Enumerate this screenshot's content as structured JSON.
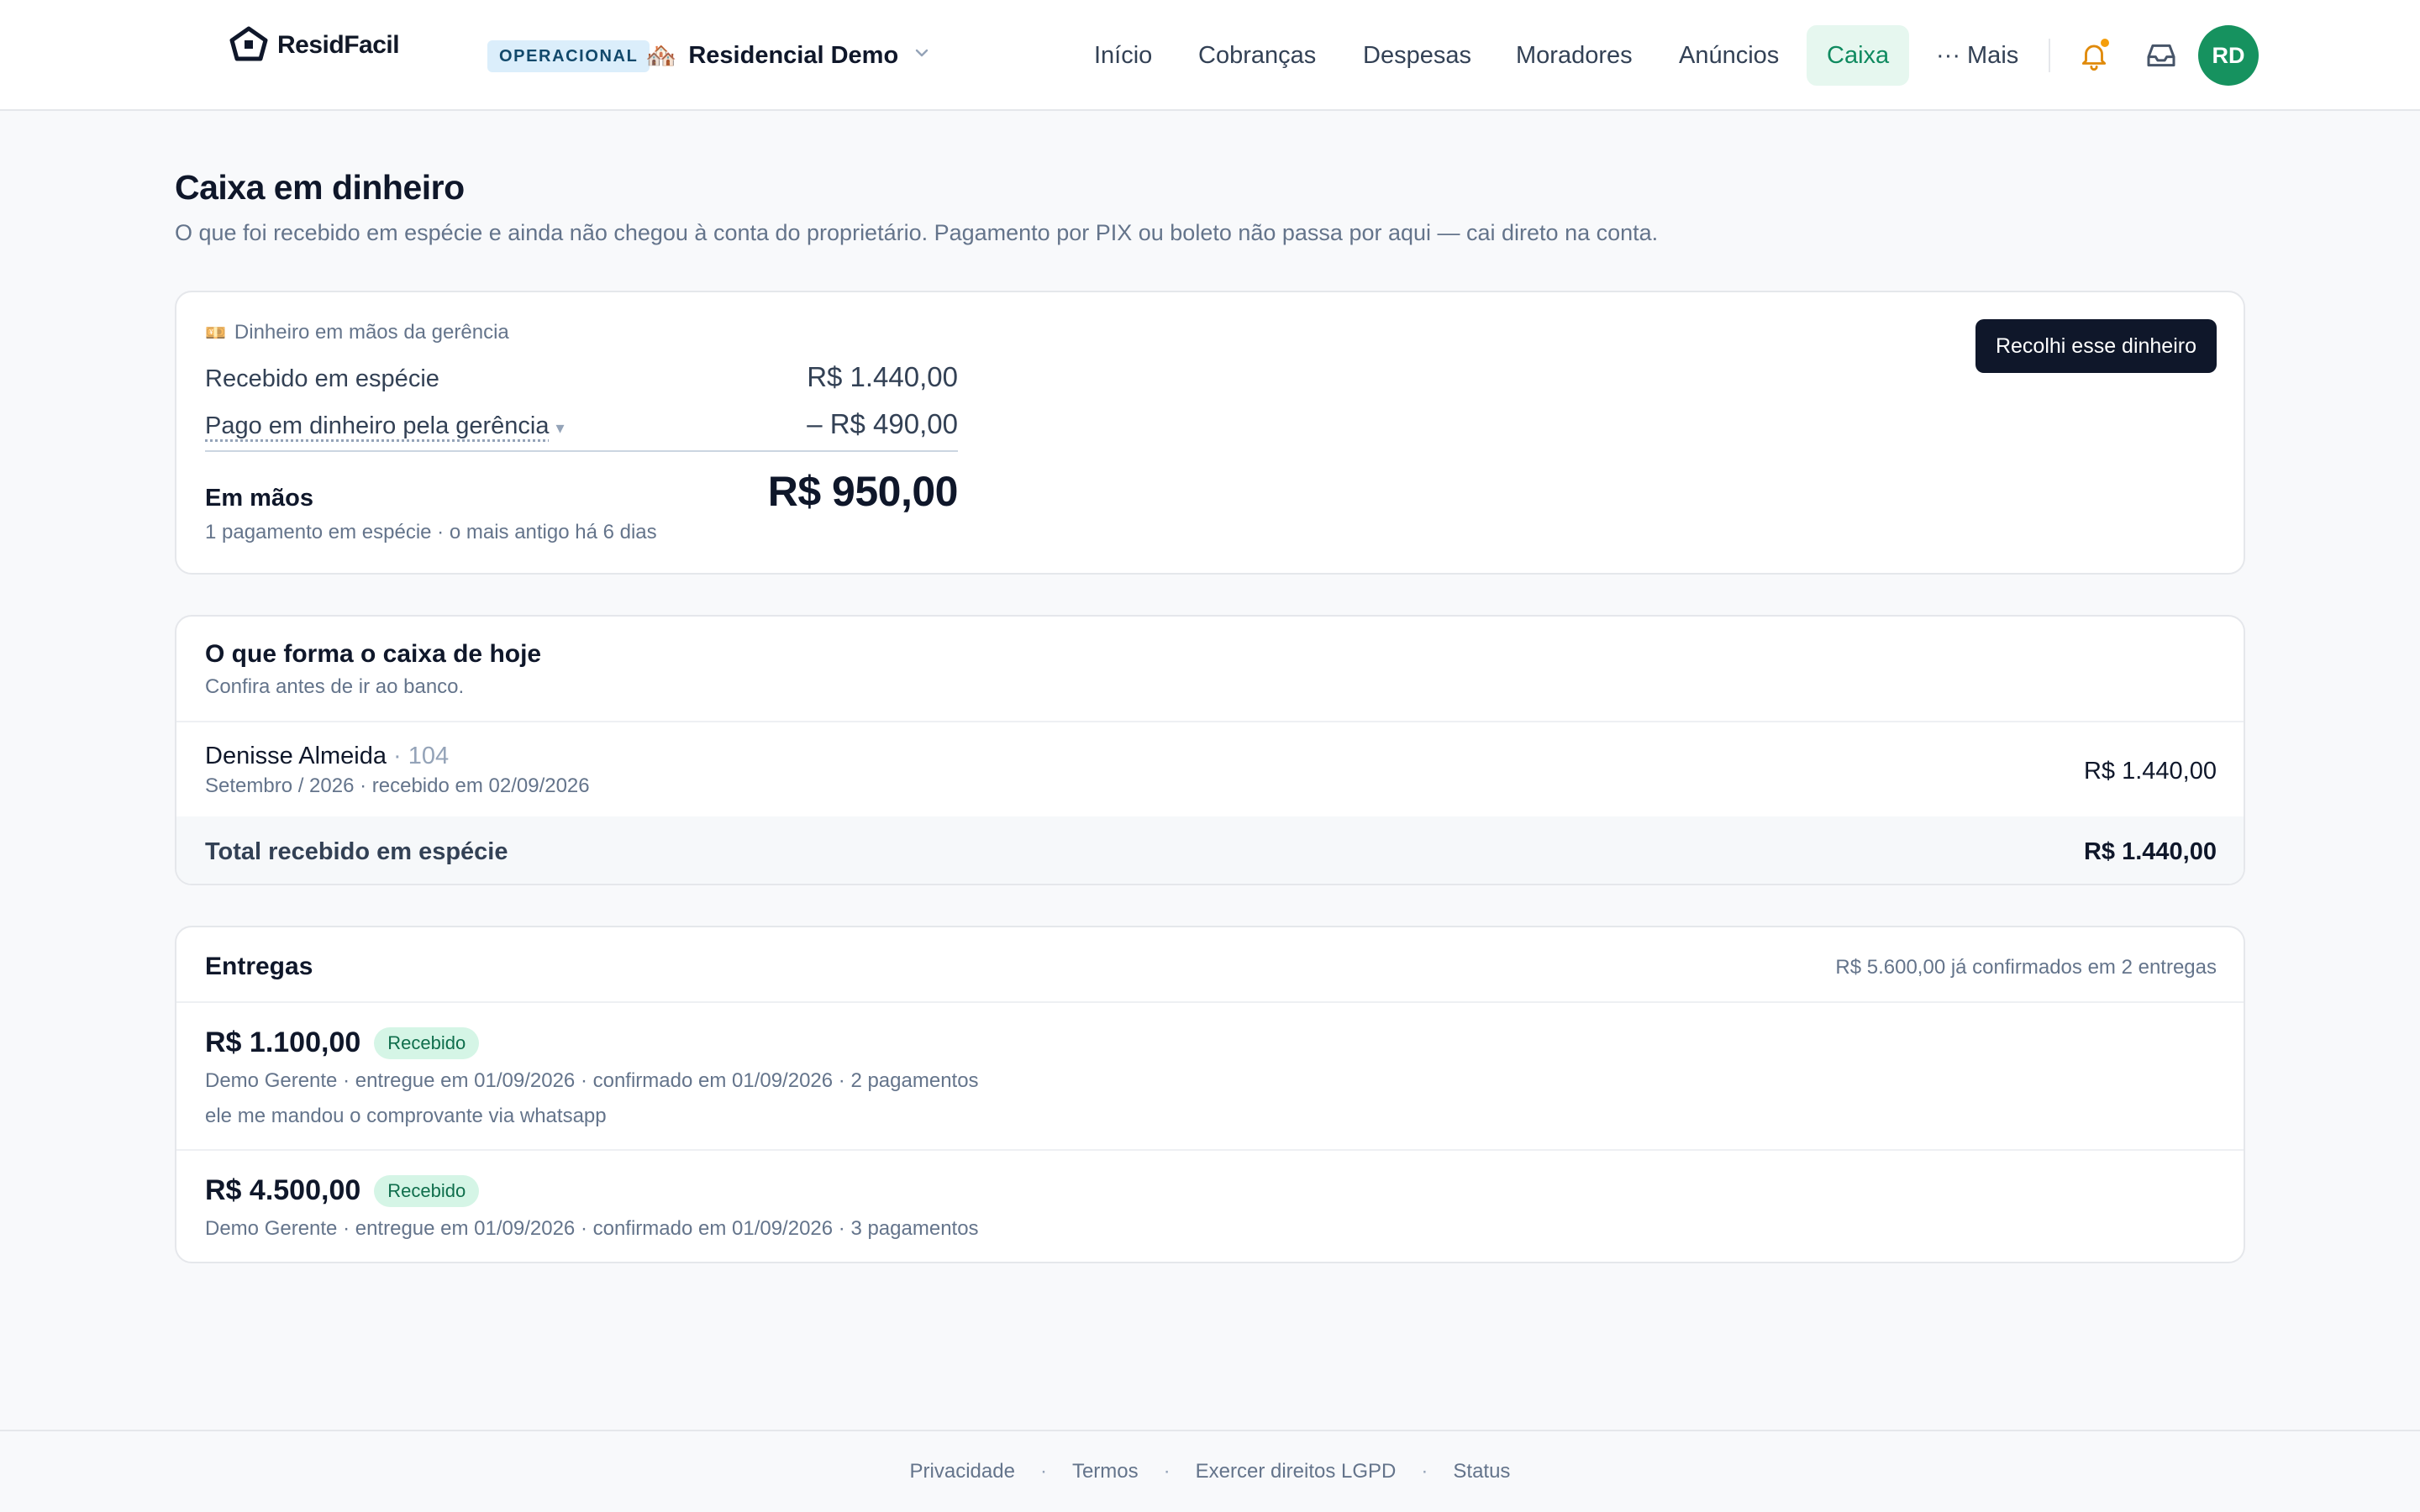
{
  "app": {
    "brand": "ResidFacil",
    "status_badge": "OPERACIONAL",
    "condo_emoji": "🏘️",
    "condo_name": "Residencial Demo"
  },
  "nav": {
    "items": [
      {
        "label": "Início",
        "active": false
      },
      {
        "label": "Cobranças",
        "active": false
      },
      {
        "label": "Despesas",
        "active": false
      },
      {
        "label": "Moradores",
        "active": false
      },
      {
        "label": "Anúncios",
        "active": false
      },
      {
        "label": "Caixa",
        "active": true
      },
      {
        "label": "··· Mais",
        "active": false
      }
    ],
    "user_initials": "RD"
  },
  "page": {
    "title": "Caixa em dinheiro",
    "subtitle": "O que foi recebido em espécie e ainda não chegou à conta do proprietário. Pagamento por PIX ou boleto não passa por aqui — cai direto na conta."
  },
  "cash_summary": {
    "kicker_emoji": "💴",
    "kicker": "Dinheiro em mãos da gerência",
    "received_label": "Recebido em espécie",
    "received_value": "R$ 1.440,00",
    "paid_label": "Pago em dinheiro pela gerência",
    "paid_value": "– R$ 490,00",
    "in_hand_label": "Em mãos",
    "in_hand_value": "R$ 950,00",
    "footnote": "1 pagamento em espécie · o mais antigo há 6 dias",
    "collect_button": "Recolhi esse dinheiro"
  },
  "today_box": {
    "title": "O que forma o caixa de hoje",
    "subtitle": "Confira antes de ir ao banco.",
    "items": [
      {
        "name": "Denisse Almeida",
        "unit": " · 104",
        "meta": "Setembro / 2026 · recebido em 02/09/2026",
        "amount": "R$ 1.440,00"
      }
    ],
    "total_label": "Total recebido em espécie",
    "total_value": "R$ 1.440,00"
  },
  "deliveries": {
    "title": "Entregas",
    "summary": "R$ 5.600,00 já confirmados em 2 entregas",
    "items": [
      {
        "amount": "R$ 1.100,00",
        "status": "Recebido",
        "meta": "Demo Gerente · entregue em 01/09/2026 · confirmado em 01/09/2026 · 2 pagamentos",
        "note": "ele me mandou o comprovante via whatsapp"
      },
      {
        "amount": "R$ 4.500,00",
        "status": "Recebido",
        "meta": "Demo Gerente · entregue em 01/09/2026 · confirmado em 01/09/2026 · 3 pagamentos"
      }
    ]
  },
  "footer": {
    "links": [
      "Privacidade",
      "Termos",
      "Exercer direitos LGPD",
      "Status"
    ]
  },
  "colors": {
    "accent": "#16925f",
    "nav_active_bg": "#e6f7ef",
    "status_badge_bg": "#dbeefb",
    "notification_dot": "#f59e0b",
    "primary_button": "#0f172a"
  },
  "icons": {
    "logo": "house-logo-icon",
    "condo_switch": "chevron-down-icon",
    "notifications": "bell-icon",
    "inbox": "inbox-icon"
  }
}
